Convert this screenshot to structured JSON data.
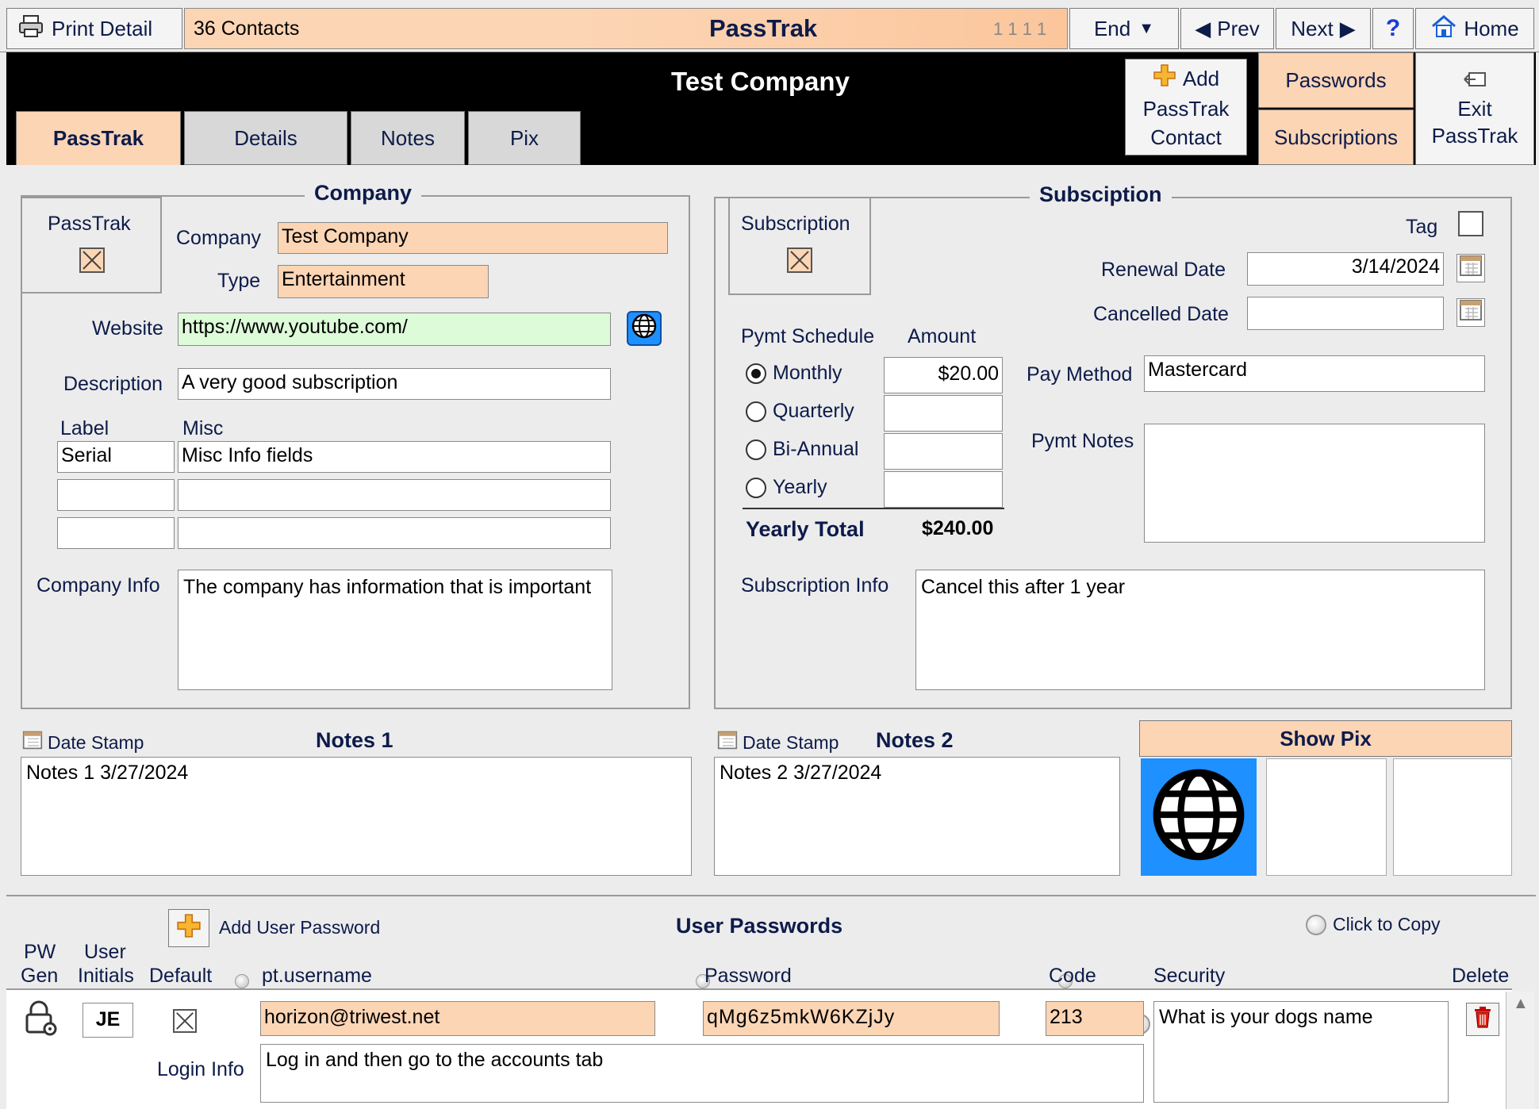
{
  "toolbar": {
    "print_detail": "Print Detail",
    "contacts_count": "36 Contacts",
    "app_title": "PassTrak",
    "record_indicator": "1 1 1 1",
    "end": "End",
    "prev": "Prev",
    "next": "Next",
    "help": "?",
    "home": "Home"
  },
  "header": {
    "record_title": "Test Company",
    "add_contact": [
      "Add",
      "PassTrak",
      "Contact"
    ],
    "passwords": "Passwords",
    "subscriptions": "Subscriptions",
    "exit": [
      "Exit",
      "PassTrak"
    ]
  },
  "tabs": [
    "PassTrak",
    "Details",
    "Notes",
    "Pix"
  ],
  "company": {
    "section_title": "Company",
    "passtrak_label": "PassTrak",
    "company_label": "Company",
    "company_value": "Test Company",
    "type_label": "Type",
    "type_value": "Entertainment",
    "website_label": "Website",
    "website_value": "https://www.youtube.com/",
    "description_label": "Description",
    "description_value": "A very good subscription",
    "label_header": "Label",
    "misc_header": "Misc",
    "misc_rows": [
      {
        "label": "Serial",
        "value": "Misc Info fields"
      },
      {
        "label": "",
        "value": ""
      },
      {
        "label": "",
        "value": ""
      }
    ],
    "info_label": "Company Info",
    "info_value": "The company has information that is important"
  },
  "subscription": {
    "section_title": "Subsciption",
    "subscription_label": "Subscription",
    "tag_label": "Tag",
    "renewal_label": "Renewal Date",
    "renewal_value": "3/14/2024",
    "cancelled_label": "Cancelled Date",
    "cancelled_value": "",
    "schedule_header": "Pymt Schedule",
    "amount_header": "Amount",
    "schedules": [
      {
        "label": "Monthly",
        "amount": "$20.00",
        "selected": true
      },
      {
        "label": "Quarterly",
        "amount": "",
        "selected": false
      },
      {
        "label": "Bi-Annual",
        "amount": "",
        "selected": false
      },
      {
        "label": "Yearly",
        "amount": "",
        "selected": false
      }
    ],
    "yearly_total_label": "Yearly Total",
    "yearly_total_value": "$240.00",
    "pay_method_label": "Pay Method",
    "pay_method_value": "Mastercard",
    "pymt_notes_label": "Pymt Notes",
    "pymt_notes_value": "",
    "info_label": "Subscription Info",
    "info_value": "Cancel this after 1 year"
  },
  "notes": {
    "date_stamp_1": "Date Stamp",
    "notes1_title": "Notes 1",
    "notes1_value": "Notes 1  3/27/2024",
    "date_stamp_2": "Date Stamp",
    "notes2_title": "Notes 2",
    "notes2_value": "Notes 2  3/27/2024",
    "show_pix": "Show Pix"
  },
  "passwords": {
    "add_user_password": "Add User Password",
    "section_title": "User Passwords",
    "click_to_copy": "Click to Copy",
    "col_pw": "PW",
    "col_gen": "Gen",
    "col_user": "User",
    "col_initials": "Initials",
    "col_default": "Default",
    "col_username": "pt.username",
    "col_password": "Password",
    "col_code": "Code",
    "col_security": "Security",
    "col_delete": "Delete",
    "row": {
      "initials": "JE",
      "username": "horizon@triwest.net",
      "password": "qMg6z5mkW6KZjJy",
      "code": "213",
      "security": "What is your dogs name",
      "login_info_label": "Login Info",
      "login_info": "Log in and then go to the accounts tab"
    }
  },
  "colors": {
    "peach": "#fcd5b5",
    "black_bar": "#000000",
    "link_green": "#ddfbd8",
    "pix_blue": "#1e90ff"
  }
}
